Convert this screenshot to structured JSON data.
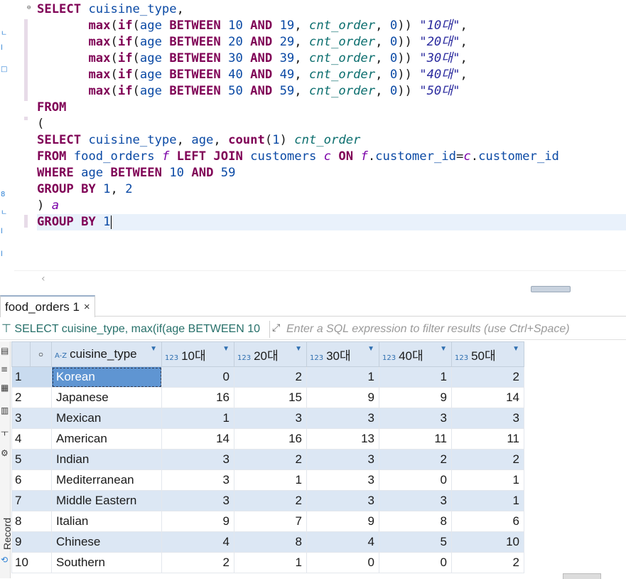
{
  "editor": {
    "lines": [
      [
        {
          "c": "kw",
          "t": "SELECT"
        },
        {
          "c": "",
          "t": " "
        },
        {
          "c": "id",
          "t": "cuisine_type"
        },
        {
          "c": "",
          "t": ","
        }
      ],
      [
        {
          "c": "",
          "t": "       "
        },
        {
          "c": "fn",
          "t": "max"
        },
        {
          "c": "",
          "t": "("
        },
        {
          "c": "kw",
          "t": "if"
        },
        {
          "c": "",
          "t": "("
        },
        {
          "c": "id",
          "t": "age"
        },
        {
          "c": "",
          "t": " "
        },
        {
          "c": "kw",
          "t": "BETWEEN"
        },
        {
          "c": "",
          "t": " "
        },
        {
          "c": "num",
          "t": "10"
        },
        {
          "c": "",
          "t": " "
        },
        {
          "c": "kw",
          "t": "AND"
        },
        {
          "c": "",
          "t": " "
        },
        {
          "c": "num",
          "t": "19"
        },
        {
          "c": "",
          "t": ", "
        },
        {
          "c": "it",
          "t": "cnt_order"
        },
        {
          "c": "",
          "t": ", "
        },
        {
          "c": "num",
          "t": "0"
        },
        {
          "c": "",
          "t": ")) "
        },
        {
          "c": "str",
          "t": "\"10대\""
        },
        {
          "c": "",
          "t": ","
        }
      ],
      [
        {
          "c": "",
          "t": "       "
        },
        {
          "c": "fn",
          "t": "max"
        },
        {
          "c": "",
          "t": "("
        },
        {
          "c": "kw",
          "t": "if"
        },
        {
          "c": "",
          "t": "("
        },
        {
          "c": "id",
          "t": "age"
        },
        {
          "c": "",
          "t": " "
        },
        {
          "c": "kw",
          "t": "BETWEEN"
        },
        {
          "c": "",
          "t": " "
        },
        {
          "c": "num",
          "t": "20"
        },
        {
          "c": "",
          "t": " "
        },
        {
          "c": "kw",
          "t": "AND"
        },
        {
          "c": "",
          "t": " "
        },
        {
          "c": "num",
          "t": "29"
        },
        {
          "c": "",
          "t": ", "
        },
        {
          "c": "it",
          "t": "cnt_order"
        },
        {
          "c": "",
          "t": ", "
        },
        {
          "c": "num",
          "t": "0"
        },
        {
          "c": "",
          "t": ")) "
        },
        {
          "c": "str",
          "t": "\"20대\""
        },
        {
          "c": "",
          "t": ","
        }
      ],
      [
        {
          "c": "",
          "t": "       "
        },
        {
          "c": "fn",
          "t": "max"
        },
        {
          "c": "",
          "t": "("
        },
        {
          "c": "kw",
          "t": "if"
        },
        {
          "c": "",
          "t": "("
        },
        {
          "c": "id",
          "t": "age"
        },
        {
          "c": "",
          "t": " "
        },
        {
          "c": "kw",
          "t": "BETWEEN"
        },
        {
          "c": "",
          "t": " "
        },
        {
          "c": "num",
          "t": "30"
        },
        {
          "c": "",
          "t": " "
        },
        {
          "c": "kw",
          "t": "AND"
        },
        {
          "c": "",
          "t": " "
        },
        {
          "c": "num",
          "t": "39"
        },
        {
          "c": "",
          "t": ", "
        },
        {
          "c": "it",
          "t": "cnt_order"
        },
        {
          "c": "",
          "t": ", "
        },
        {
          "c": "num",
          "t": "0"
        },
        {
          "c": "",
          "t": ")) "
        },
        {
          "c": "str",
          "t": "\"30대\""
        },
        {
          "c": "",
          "t": ","
        }
      ],
      [
        {
          "c": "",
          "t": "       "
        },
        {
          "c": "fn",
          "t": "max"
        },
        {
          "c": "",
          "t": "("
        },
        {
          "c": "kw",
          "t": "if"
        },
        {
          "c": "",
          "t": "("
        },
        {
          "c": "id",
          "t": "age"
        },
        {
          "c": "",
          "t": " "
        },
        {
          "c": "kw",
          "t": "BETWEEN"
        },
        {
          "c": "",
          "t": " "
        },
        {
          "c": "num",
          "t": "40"
        },
        {
          "c": "",
          "t": " "
        },
        {
          "c": "kw",
          "t": "AND"
        },
        {
          "c": "",
          "t": " "
        },
        {
          "c": "num",
          "t": "49"
        },
        {
          "c": "",
          "t": ", "
        },
        {
          "c": "it",
          "t": "cnt_order"
        },
        {
          "c": "",
          "t": ", "
        },
        {
          "c": "num",
          "t": "0"
        },
        {
          "c": "",
          "t": ")) "
        },
        {
          "c": "str",
          "t": "\"40대\""
        },
        {
          "c": "",
          "t": ","
        }
      ],
      [
        {
          "c": "",
          "t": "       "
        },
        {
          "c": "fn",
          "t": "max"
        },
        {
          "c": "",
          "t": "("
        },
        {
          "c": "kw",
          "t": "if"
        },
        {
          "c": "",
          "t": "("
        },
        {
          "c": "id",
          "t": "age"
        },
        {
          "c": "",
          "t": " "
        },
        {
          "c": "kw",
          "t": "BETWEEN"
        },
        {
          "c": "",
          "t": " "
        },
        {
          "c": "num",
          "t": "50"
        },
        {
          "c": "",
          "t": " "
        },
        {
          "c": "kw",
          "t": "AND"
        },
        {
          "c": "",
          "t": " "
        },
        {
          "c": "num",
          "t": "59"
        },
        {
          "c": "",
          "t": ", "
        },
        {
          "c": "it",
          "t": "cnt_order"
        },
        {
          "c": "",
          "t": ", "
        },
        {
          "c": "num",
          "t": "0"
        },
        {
          "c": "",
          "t": ")) "
        },
        {
          "c": "str",
          "t": "\"50대\""
        }
      ],
      [
        {
          "c": "kw",
          "t": "FROM"
        }
      ],
      [
        {
          "c": "",
          "t": "("
        }
      ],
      [
        {
          "c": "kw",
          "t": "SELECT"
        },
        {
          "c": "",
          "t": " "
        },
        {
          "c": "id",
          "t": "cuisine_type"
        },
        {
          "c": "",
          "t": ", "
        },
        {
          "c": "id",
          "t": "age"
        },
        {
          "c": "",
          "t": ", "
        },
        {
          "c": "fn",
          "t": "count"
        },
        {
          "c": "",
          "t": "("
        },
        {
          "c": "num",
          "t": "1"
        },
        {
          "c": "",
          "t": ") "
        },
        {
          "c": "it",
          "t": "cnt_order"
        }
      ],
      [
        {
          "c": "kw",
          "t": "FROM"
        },
        {
          "c": "",
          "t": " "
        },
        {
          "c": "id",
          "t": "food_orders"
        },
        {
          "c": "",
          "t": " "
        },
        {
          "c": "al",
          "t": "f"
        },
        {
          "c": "",
          "t": " "
        },
        {
          "c": "kw",
          "t": "LEFT JOIN"
        },
        {
          "c": "",
          "t": " "
        },
        {
          "c": "id",
          "t": "customers"
        },
        {
          "c": "",
          "t": " "
        },
        {
          "c": "al",
          "t": "c"
        },
        {
          "c": "",
          "t": " "
        },
        {
          "c": "kw",
          "t": "ON"
        },
        {
          "c": "",
          "t": " "
        },
        {
          "c": "al",
          "t": "f"
        },
        {
          "c": "",
          "t": "."
        },
        {
          "c": "id",
          "t": "customer_id"
        },
        {
          "c": "",
          "t": "="
        },
        {
          "c": "al",
          "t": "c"
        },
        {
          "c": "",
          "t": "."
        },
        {
          "c": "id",
          "t": "customer_id"
        }
      ],
      [
        {
          "c": "kw",
          "t": "WHERE"
        },
        {
          "c": "",
          "t": " "
        },
        {
          "c": "id",
          "t": "age"
        },
        {
          "c": "",
          "t": " "
        },
        {
          "c": "kw",
          "t": "BETWEEN"
        },
        {
          "c": "",
          "t": " "
        },
        {
          "c": "num",
          "t": "10"
        },
        {
          "c": "",
          "t": " "
        },
        {
          "c": "kw",
          "t": "AND"
        },
        {
          "c": "",
          "t": " "
        },
        {
          "c": "num",
          "t": "59"
        }
      ],
      [
        {
          "c": "kw",
          "t": "GROUP BY"
        },
        {
          "c": "",
          "t": " "
        },
        {
          "c": "num",
          "t": "1"
        },
        {
          "c": "",
          "t": ", "
        },
        {
          "c": "num",
          "t": "2"
        }
      ],
      [
        {
          "c": "",
          "t": ") "
        },
        {
          "c": "al",
          "t": "a"
        }
      ],
      [
        {
          "c": "kw",
          "t": "GROUP BY"
        },
        {
          "c": "",
          "t": " "
        },
        {
          "c": "num",
          "t": "1"
        }
      ]
    ],
    "current_line_index": 13
  },
  "results": {
    "tab_label": "food_orders 1",
    "tab_close": "×",
    "filter_query": "SELECT cuisine_type, max(if(age BETWEEN 10",
    "filter_placeholder": "Enter a SQL expression to filter results (use Ctrl+Space)",
    "side_label": "Record",
    "columns": [
      {
        "name": "cuisine_type",
        "type_icon": "A-Z"
      },
      {
        "name": "10대",
        "type_icon": "123"
      },
      {
        "name": "20대",
        "type_icon": "123"
      },
      {
        "name": "30대",
        "type_icon": "123"
      },
      {
        "name": "40대",
        "type_icon": "123"
      },
      {
        "name": "50대",
        "type_icon": "123"
      }
    ],
    "rows": [
      {
        "n": "1",
        "cuisine": "Korean",
        "v": [
          "0",
          "2",
          "1",
          "1",
          "2"
        ]
      },
      {
        "n": "2",
        "cuisine": "Japanese",
        "v": [
          "16",
          "15",
          "9",
          "9",
          "14"
        ]
      },
      {
        "n": "3",
        "cuisine": "Mexican",
        "v": [
          "1",
          "3",
          "3",
          "3",
          "3"
        ]
      },
      {
        "n": "4",
        "cuisine": "American",
        "v": [
          "14",
          "16",
          "13",
          "11",
          "11"
        ]
      },
      {
        "n": "5",
        "cuisine": "Indian",
        "v": [
          "3",
          "2",
          "3",
          "2",
          "2"
        ]
      },
      {
        "n": "6",
        "cuisine": "Mediterranean",
        "v": [
          "3",
          "1",
          "3",
          "0",
          "1"
        ]
      },
      {
        "n": "7",
        "cuisine": "Middle Eastern",
        "v": [
          "3",
          "2",
          "3",
          "3",
          "1"
        ]
      },
      {
        "n": "8",
        "cuisine": "Italian",
        "v": [
          "9",
          "7",
          "9",
          "8",
          "6"
        ]
      },
      {
        "n": "9",
        "cuisine": "Chinese",
        "v": [
          "4",
          "8",
          "4",
          "5",
          "10"
        ]
      },
      {
        "n": "10",
        "cuisine": "Southern",
        "v": [
          "2",
          "1",
          "0",
          "0",
          "2"
        ]
      }
    ],
    "selected_row_index": 0
  },
  "colors": {
    "keyword": "#7f0055",
    "identifier": "#0b4aa5",
    "header_bg": "#dbe6f3",
    "alt_row_bg": "#dce7f4",
    "selected_cell_bg": "#5f95d2"
  }
}
